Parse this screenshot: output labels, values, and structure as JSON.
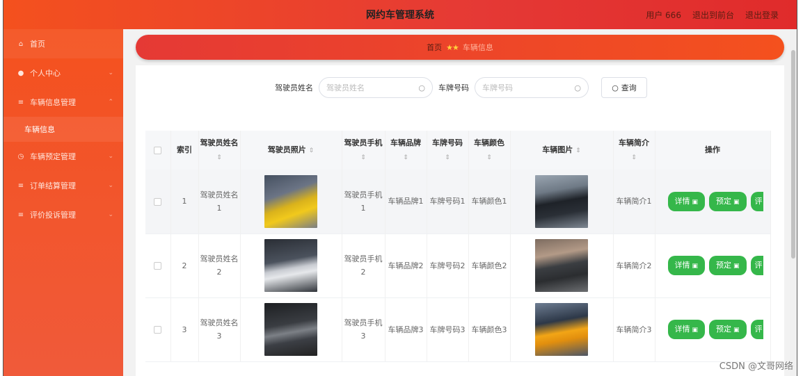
{
  "header": {
    "title": "网约车管理系统",
    "user": "用户 666",
    "back_front": "退出到前台",
    "logout": "退出登录"
  },
  "sidebar": {
    "items": [
      {
        "label": "首页",
        "icon": "home-icon"
      },
      {
        "label": "个人中心",
        "icon": "user-icon"
      },
      {
        "label": "车辆信息管理",
        "icon": "menu-icon",
        "sub": "车辆信息"
      },
      {
        "label": "车辆预定管理",
        "icon": "clock-icon"
      },
      {
        "label": "订单结算管理",
        "icon": "list-icon"
      },
      {
        "label": "评价投诉管理",
        "icon": "list-icon"
      }
    ]
  },
  "breadcrumb": {
    "home": "首页",
    "stars": "★★",
    "current": "车辆信息"
  },
  "search": {
    "driver_label": "驾驶员姓名",
    "driver_placeholder": "驾驶员姓名",
    "plate_label": "车牌号码",
    "plate_placeholder": "车牌号码",
    "button": "查询"
  },
  "table": {
    "headers": {
      "index": "索引",
      "driver_name": "驾驶员姓名",
      "driver_photo": "驾驶员照片",
      "driver_phone": "驾驶员手机",
      "brand": "车辆品牌",
      "plate": "车牌号码",
      "color": "车辆颜色",
      "car_image": "车辆图片",
      "intro": "车辆简介",
      "actions": "操作"
    },
    "rows": [
      {
        "index": "1",
        "driver_name": "驾驶员姓名1",
        "driver_phone": "驾驶员手机1",
        "brand": "车辆品牌1",
        "plate": "车牌号码1",
        "color": "车辆颜色1",
        "intro": "车辆简介1"
      },
      {
        "index": "2",
        "driver_name": "驾驶员姓名2",
        "driver_phone": "驾驶员手机2",
        "brand": "车辆品牌2",
        "plate": "车牌号码2",
        "color": "车辆颜色2",
        "intro": "车辆简介2"
      },
      {
        "index": "3",
        "driver_name": "驾驶员姓名3",
        "driver_phone": "驾驶员手机3",
        "brand": "车辆品牌3",
        "plate": "车牌号码3",
        "color": "车辆颜色3",
        "intro": "车辆简介3"
      }
    ],
    "btn_detail": "详情",
    "btn_reserve": "预定",
    "btn_more": "评"
  },
  "watermark": "CSDN @文哥网络",
  "colors": {
    "primary": "#e53935",
    "sidebar": "#f4511e",
    "action_green": "#35b74a"
  }
}
